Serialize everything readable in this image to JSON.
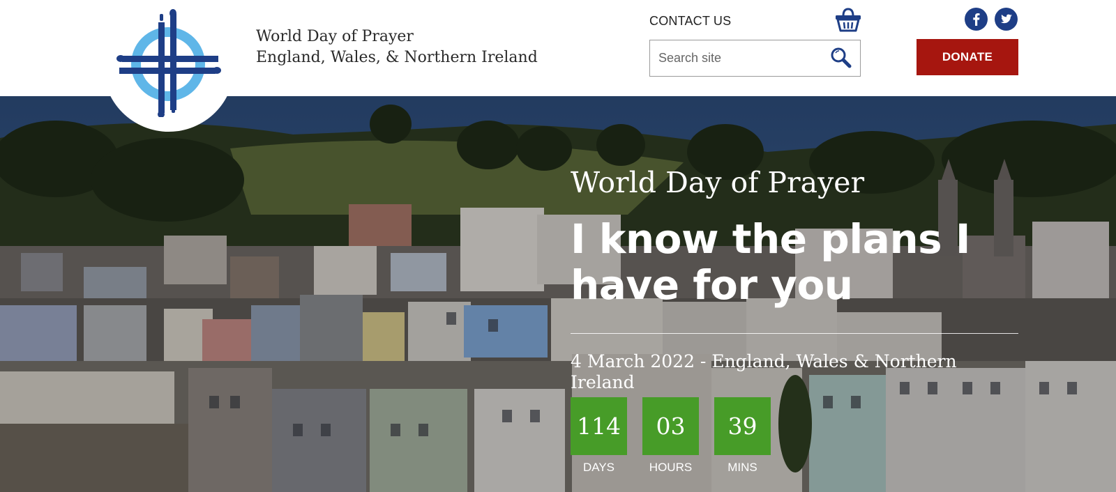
{
  "brand": {
    "logo_icon": "world-day-of-prayer-cross-logo",
    "name_line1": "World Day of Prayer",
    "name_line2": "England, Wales, & Northern Ireland",
    "colors": {
      "navy": "#1e3e86",
      "light_blue": "#5fb6e8"
    }
  },
  "header": {
    "contact_label": "CONTACT US",
    "basket_icon": "shopping-basket-icon",
    "search": {
      "placeholder": "Search site",
      "value": "",
      "icon": "magnifier-icon"
    },
    "social": [
      {
        "name": "facebook",
        "icon": "facebook-icon"
      },
      {
        "name": "twitter",
        "icon": "twitter-icon"
      }
    ],
    "donate_label": "DONATE",
    "donate_color": "#a6160f"
  },
  "hero": {
    "kicker": "World Day of Prayer",
    "headline": "I know the plans I have for you",
    "event_date": "4 March 2022 - England, Wales & Northern Ireland",
    "countdown": [
      {
        "value": "114",
        "label": "DAYS"
      },
      {
        "value": "03",
        "label": "HOURS"
      },
      {
        "value": "39",
        "label": "MINS"
      }
    ],
    "countdown_color": "#479c28"
  }
}
